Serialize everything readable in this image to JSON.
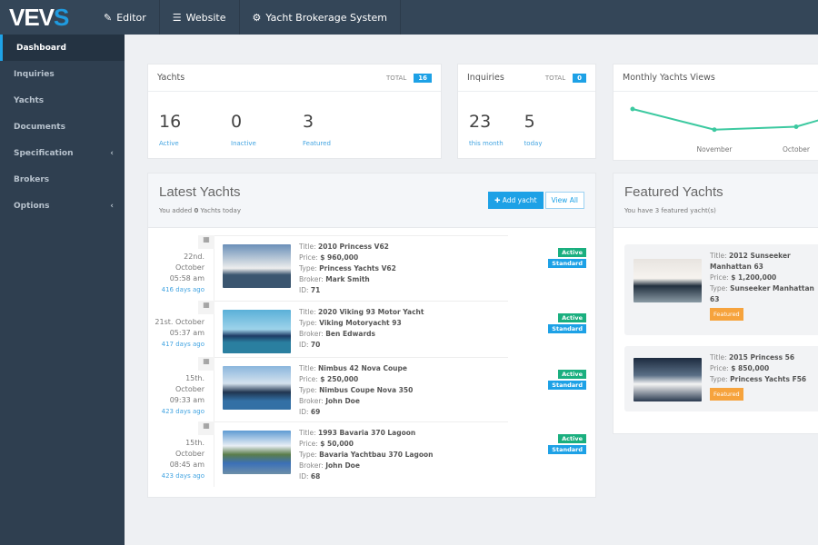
{
  "topbar": {
    "logo": "VEVS",
    "nav": [
      {
        "label": "Editor",
        "icon": "pencil-icon"
      },
      {
        "label": "Website",
        "icon": "list-icon"
      },
      {
        "label": "Yacht Brokerage System",
        "icon": "gear-icon"
      }
    ]
  },
  "sidebar": {
    "items": [
      {
        "label": "Dashboard",
        "active": true
      },
      {
        "label": "Inquiries"
      },
      {
        "label": "Yachts"
      },
      {
        "label": "Documents"
      },
      {
        "label": "Specification",
        "chevron": true
      },
      {
        "label": "Brokers"
      },
      {
        "label": "Options",
        "chevron": true
      }
    ]
  },
  "yachts_card": {
    "title": "Yachts",
    "total_label": "TOTAL",
    "total": "16",
    "stats": [
      {
        "value": "16",
        "label": "Active"
      },
      {
        "value": "0",
        "label": "Inactive"
      },
      {
        "value": "3",
        "label": "Featured"
      }
    ]
  },
  "inquiries_card": {
    "title": "Inquiries",
    "total_label": "TOTAL",
    "total": "0",
    "stats": [
      {
        "value": "23",
        "label": "this month"
      },
      {
        "value": "5",
        "label": "today"
      }
    ]
  },
  "views_card": {
    "title": "Monthly Yachts Views"
  },
  "chart_data": {
    "type": "line",
    "categories": [
      "",
      "November",
      "October",
      ""
    ],
    "values": [
      12,
      5,
      6,
      14
    ],
    "color": "#3cc9a0",
    "grid": false
  },
  "latest": {
    "title": "Latest Yachts",
    "subtitle_pre": "You added ",
    "subtitle_count": "0",
    "subtitle_post": " Yachts today",
    "add_label": "Add yacht",
    "view_all": "View All",
    "labels": {
      "title": "Title: ",
      "price": "Price: ",
      "type": "Type: ",
      "broker": "Broker: ",
      "id": "ID: "
    },
    "rows": [
      {
        "date1": "22nd.",
        "date2": "October",
        "time": "05:58 am",
        "ago": "416 days ago",
        "title": "2010 Princess V62",
        "price": "$ 960,000",
        "type": "Princess Yachts V62",
        "broker": "Mark Smith",
        "id": "71",
        "status": "Active",
        "plan": "Standard"
      },
      {
        "date1": "21st. October",
        "date2": "",
        "time": "05:37 am",
        "ago": "417 days ago",
        "title": "2020 Viking 93 Motor Yacht",
        "price": "",
        "type": "Viking Motoryacht 93",
        "broker": "Ben Edwards",
        "id": "70",
        "status": "Active",
        "plan": "Standard"
      },
      {
        "date1": "15th.",
        "date2": "October",
        "time": "09:33 am",
        "ago": "423 days ago",
        "title": "Nimbus 42 Nova Coupe",
        "price": "$ 250,000",
        "type": "Nimbus Coupe Nova 350",
        "broker": "John Doe",
        "id": "69",
        "status": "Active",
        "plan": "Standard"
      },
      {
        "date1": "15th.",
        "date2": "October",
        "time": "08:45 am",
        "ago": "423 days ago",
        "title": "1993 Bavaria 370 Lagoon",
        "price": "$ 50,000",
        "type": "Bavaria Yachtbau 370 Lagoon",
        "broker": "John Doe",
        "id": "68",
        "status": "Active",
        "plan": "Standard"
      }
    ]
  },
  "featured": {
    "title": "Featured Yachts",
    "subtitle": "You have 3 featured yacht(s)",
    "badge": "Featured",
    "items": [
      {
        "title": "2012 Sunseeker Manhattan 63",
        "price": "$ 1,200,000",
        "type": "Sunseeker Manhattan 63"
      },
      {
        "title": "2015 Princess 56",
        "price": "$ 850,000",
        "type": "Princess Yachts F56"
      }
    ]
  },
  "colors": {
    "accent": "#1da1e6",
    "active": "#1aaf7f",
    "featured": "#f6a33d",
    "topbar": "#344658",
    "sidebar": "#2f3f50"
  }
}
